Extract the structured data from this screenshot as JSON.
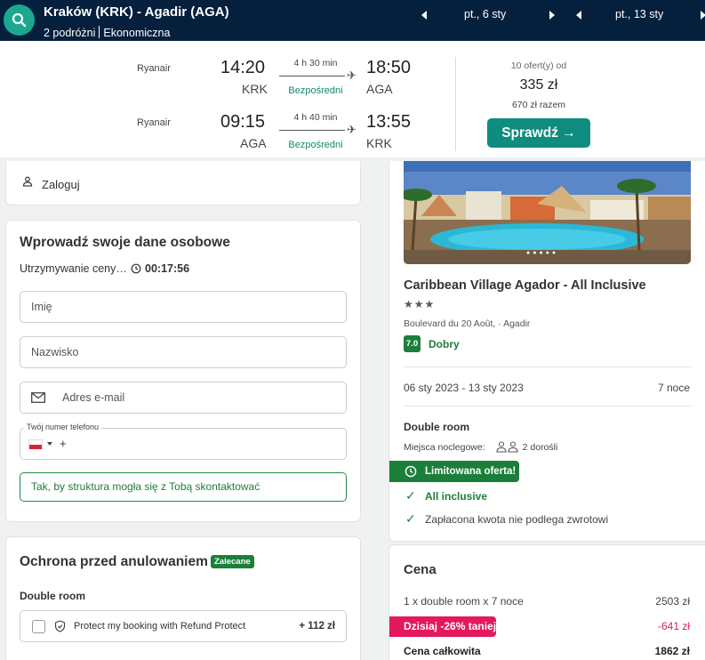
{
  "header": {
    "route": "Kraków (KRK) - Agadir (AGA)",
    "travellers": "2 podróżni",
    "cabin": "Ekonomiczna",
    "depart_date": "pt., 6 sty",
    "return_date": "pt., 13 sty",
    "search_icon": "search-icon"
  },
  "flights": [
    {
      "airline": "Ryanair",
      "dep_time": "14:20",
      "dep_code": "KRK",
      "duration": "4 h 30 min",
      "stops": "Bezpośredni",
      "arr_time": "18:50",
      "arr_code": "AGA"
    },
    {
      "airline": "Ryanair",
      "dep_time": "09:15",
      "dep_code": "AGA",
      "duration": "4 h 40 min",
      "stops": "Bezpośredni",
      "arr_time": "13:55",
      "arr_code": "KRK"
    }
  ],
  "offer": {
    "count": "10 ofert(y) od",
    "price": "335 zł",
    "total": "670 zł razem",
    "button": "Sprawdź →"
  },
  "login": {
    "label": "Zaloguj"
  },
  "personal": {
    "title": "Wprowadź swoje dane osobowe",
    "hold_label": "Utrzymywanie ceny…",
    "hold_time": "00:17:56",
    "first_name_placeholder": "Imię",
    "last_name_placeholder": "Nazwisko",
    "email_placeholder": "Adres e-mail",
    "phone_label": "Twój numer telefonu",
    "phone_prefix": "+",
    "contact_hint": "Tak, by struktura mogła się z Tobą skontaktować"
  },
  "cancellation": {
    "title": "Ochrona przed anulowaniem",
    "badge": "Zalecane",
    "room": "Double room",
    "refund_text": "Protect my booking with Refund Protect",
    "refund_price": "+ 112 zł"
  },
  "hotel": {
    "name": "Caribbean Village Agador - All Inclusive",
    "stars": "★★★",
    "address": "Boulevard du 20 Août, · Agadir",
    "score": "7.0",
    "score_label": "Dobry",
    "dates": "06 sty 2023 - 13 sty 2023",
    "nights": "7 noce",
    "room": "Double room",
    "beds_label": "Miejsca noclegowe:",
    "beds_value": "2 dorośli",
    "limited_offer": "Limitowana oferta!",
    "features": [
      {
        "text": "All inclusive",
        "highlight": true
      },
      {
        "text": "Zapłacona kwota nie podlega zwrotowi",
        "highlight": false
      }
    ]
  },
  "price": {
    "title": "Cena",
    "line_label": "1 x double room x 7 nocе",
    "line_value": "2503 zł",
    "discount_label": "Dzisiaj -26% taniej",
    "discount_value": "-641 zł",
    "total_label": "Cena całkowita",
    "total_value": "1862 zł"
  },
  "colors": {
    "navbar": "#05203c",
    "accent": "#0e8c7f",
    "green": "#1b7f3a",
    "pink": "#e4185f"
  }
}
